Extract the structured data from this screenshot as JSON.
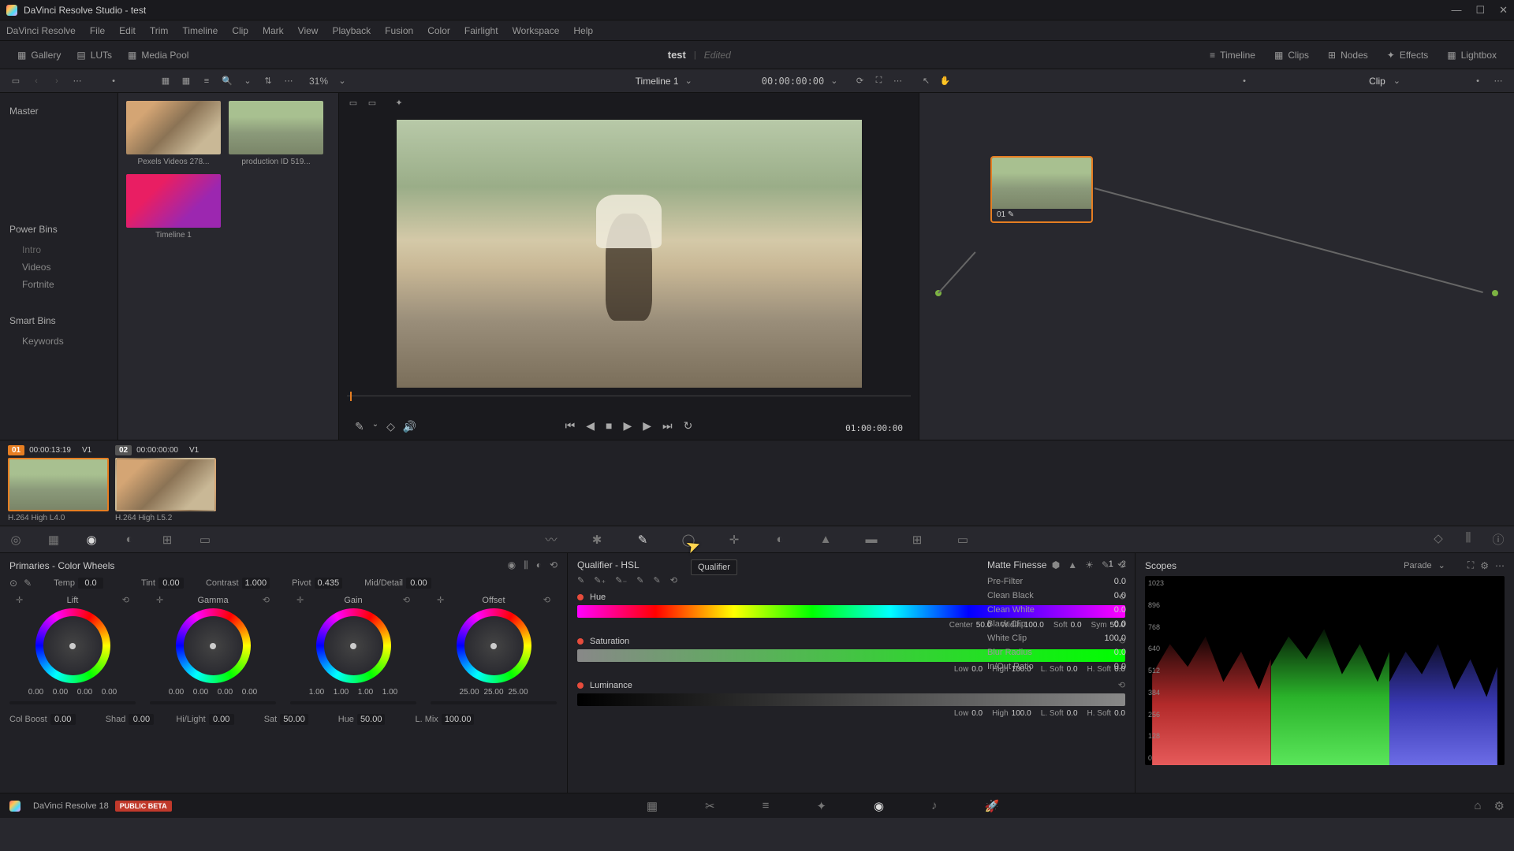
{
  "titlebar": {
    "title": "DaVinci Resolve Studio - test"
  },
  "menu": [
    "DaVinci Resolve",
    "File",
    "Edit",
    "Trim",
    "Timeline",
    "Clip",
    "Mark",
    "View",
    "Playback",
    "Fusion",
    "Color",
    "Fairlight",
    "Workspace",
    "Help"
  ],
  "toolbar": {
    "gallery": "Gallery",
    "luts": "LUTs",
    "mediapool": "Media Pool",
    "project": "test",
    "status": "Edited",
    "timeline": "Timeline",
    "clips": "Clips",
    "nodes": "Nodes",
    "effects": "Effects",
    "lightbox": "Lightbox"
  },
  "secondary": {
    "zoom": "31%",
    "timeline_name": "Timeline 1",
    "timecode": "00:00:00:00",
    "clip": "Clip"
  },
  "sidebar": {
    "master": "Master",
    "powerbins": "Power Bins",
    "bins": [
      "Intro",
      "Videos",
      "Fortnite"
    ],
    "smartbins": "Smart Bins",
    "keywords": "Keywords"
  },
  "media": [
    {
      "label": "Pexels Videos 278..."
    },
    {
      "label": "production ID 519..."
    },
    {
      "label": "Timeline 1"
    }
  ],
  "viewer": {
    "timecode": "01:00:00:00"
  },
  "node": {
    "label": "01"
  },
  "thumbnails": [
    {
      "badge": "01",
      "tc": "00:00:13:19",
      "track": "V1",
      "caption": "H.264 High L4.0"
    },
    {
      "badge": "02",
      "tc": "00:00:00:00",
      "track": "V1",
      "caption": "H.264 High L5.2"
    }
  ],
  "tooltip": "Qualifier",
  "primaries": {
    "title": "Primaries - Color Wheels",
    "params1": [
      {
        "label": "Temp",
        "val": "0.0"
      },
      {
        "label": "Tint",
        "val": "0.00"
      },
      {
        "label": "Contrast",
        "val": "1.000"
      },
      {
        "label": "Pivot",
        "val": "0.435"
      },
      {
        "label": "Mid/Detail",
        "val": "0.00"
      }
    ],
    "wheels": [
      {
        "name": "Lift",
        "vals": [
          "0.00",
          "0.00",
          "0.00",
          "0.00"
        ]
      },
      {
        "name": "Gamma",
        "vals": [
          "0.00",
          "0.00",
          "0.00",
          "0.00"
        ]
      },
      {
        "name": "Gain",
        "vals": [
          "1.00",
          "1.00",
          "1.00",
          "1.00"
        ]
      },
      {
        "name": "Offset",
        "vals": [
          "25.00",
          "25.00",
          "25.00"
        ]
      }
    ],
    "params2": [
      {
        "label": "Col Boost",
        "val": "0.00"
      },
      {
        "label": "Shad",
        "val": "0.00"
      },
      {
        "label": "Hi/Light",
        "val": "0.00"
      },
      {
        "label": "Sat",
        "val": "50.00"
      },
      {
        "label": "Hue",
        "val": "50.00"
      },
      {
        "label": "L. Mix",
        "val": "100.00"
      }
    ]
  },
  "qualifier": {
    "title": "Qualifier - HSL",
    "hue": {
      "title": "Hue",
      "params": [
        {
          "l": "Center",
          "v": "50.0"
        },
        {
          "l": "Width",
          "v": "100.0"
        },
        {
          "l": "Soft",
          "v": "0.0"
        },
        {
          "l": "Sym",
          "v": "50.0"
        }
      ]
    },
    "sat": {
      "title": "Saturation",
      "params": [
        {
          "l": "Low",
          "v": "0.0"
        },
        {
          "l": "High",
          "v": "100.0"
        },
        {
          "l": "L. Soft",
          "v": "0.0"
        },
        {
          "l": "H. Soft",
          "v": "0.0"
        }
      ]
    },
    "lum": {
      "title": "Luminance",
      "params": [
        {
          "l": "Low",
          "v": "0.0"
        },
        {
          "l": "High",
          "v": "100.0"
        },
        {
          "l": "L. Soft",
          "v": "0.0"
        },
        {
          "l": "H. Soft",
          "v": "0.0"
        }
      ]
    }
  },
  "matte": {
    "title": "Matte Finesse",
    "tab1": "1",
    "tab2": "2",
    "rows": [
      {
        "l": "Pre-Filter",
        "v": "0.0"
      },
      {
        "l": "Clean Black",
        "v": "0.0"
      },
      {
        "l": "Clean White",
        "v": "0.0"
      },
      {
        "l": "Black Clip",
        "v": "0.0"
      },
      {
        "l": "White Clip",
        "v": "100.0"
      },
      {
        "l": "Blur Radius",
        "v": "0.0"
      },
      {
        "l": "In/Out Ratio",
        "v": "0.0"
      }
    ]
  },
  "scopes": {
    "title": "Scopes",
    "mode": "Parade",
    "labels": [
      "1023",
      "896",
      "768",
      "640",
      "512",
      "384",
      "256",
      "128",
      "0"
    ]
  },
  "bottom": {
    "title": "DaVinci Resolve 18",
    "beta": "PUBLIC BETA"
  }
}
